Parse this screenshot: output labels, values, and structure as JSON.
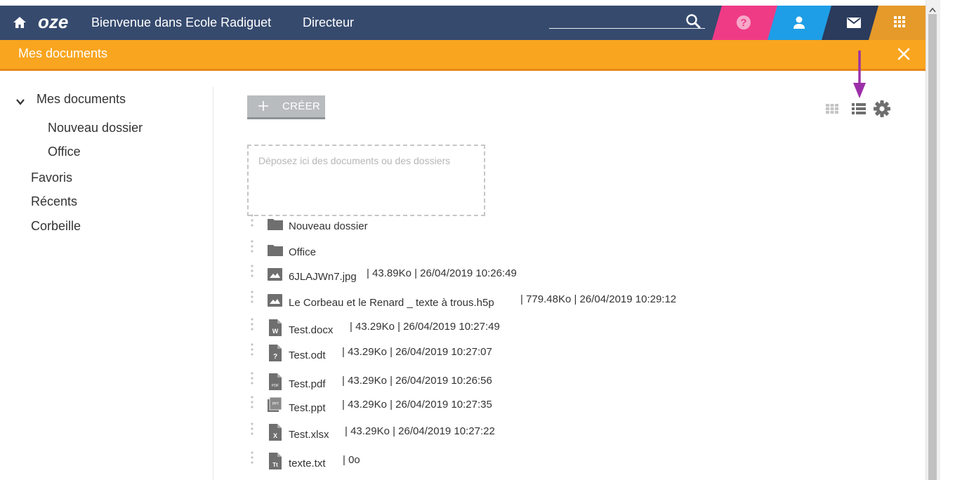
{
  "header": {
    "welcome": "Bienvenue dans Ecole Radiguet",
    "role": "Directeur",
    "logo": "oze",
    "icons": [
      "home-icon",
      "search-icon",
      "help-icon",
      "user-icon",
      "mail-icon",
      "apps-grid-icon"
    ],
    "tab_colors": [
      "#ef3b86",
      "#1e9ee6",
      "#2a3b5c",
      "#e59a2a"
    ]
  },
  "subheader": {
    "title": "Mes documents"
  },
  "sidebar": {
    "root": "Mes documents",
    "children": [
      "Nouveau dossier",
      "Office"
    ],
    "items": [
      "Favoris",
      "Récents",
      "Corbeille"
    ]
  },
  "toolbar": {
    "create_label": "CRÉER"
  },
  "dropzone": {
    "text": "Déposez ici des documents ou des dossiers"
  },
  "files": [
    {
      "name": "Nouveau dossier",
      "meta": "",
      "icon": "folder-icon"
    },
    {
      "name": "Office",
      "meta": "",
      "icon": "folder-icon"
    },
    {
      "name": "6JLAJWn7.jpg",
      "meta": "| 43.89Ko | 26/04/2019 10:26:49",
      "icon": "image-file-icon"
    },
    {
      "name": "Le Corbeau et le Renard _ texte à trous.h5p",
      "meta": "| 779.48Ko | 26/04/2019 10:29:12",
      "icon": "image-file-icon"
    },
    {
      "name": "Test.docx",
      "meta": "| 43.29Ko | 26/04/2019 10:27:49",
      "icon": "word-file-icon"
    },
    {
      "name": "Test.odt",
      "meta": "| 43.29Ko | 26/04/2019 10:27:07",
      "icon": "unknown-file-icon"
    },
    {
      "name": "Test.pdf",
      "meta": "| 43.29Ko | 26/04/2019 10:26:56",
      "icon": "pdf-file-icon"
    },
    {
      "name": "Test.ppt",
      "meta": "| 43.29Ko | 26/04/2019 10:27:35",
      "icon": "ppt-file-icon"
    },
    {
      "name": "Test.xlsx",
      "meta": "| 43.29Ko | 26/04/2019 10:27:22",
      "icon": "excel-file-icon"
    },
    {
      "name": "texte.txt",
      "meta": "| 0o",
      "icon": "text-file-icon"
    }
  ],
  "colors": {
    "header": "#364a6e",
    "accent_orange": "#f9a51f",
    "arrow": "#9b2fa8"
  }
}
